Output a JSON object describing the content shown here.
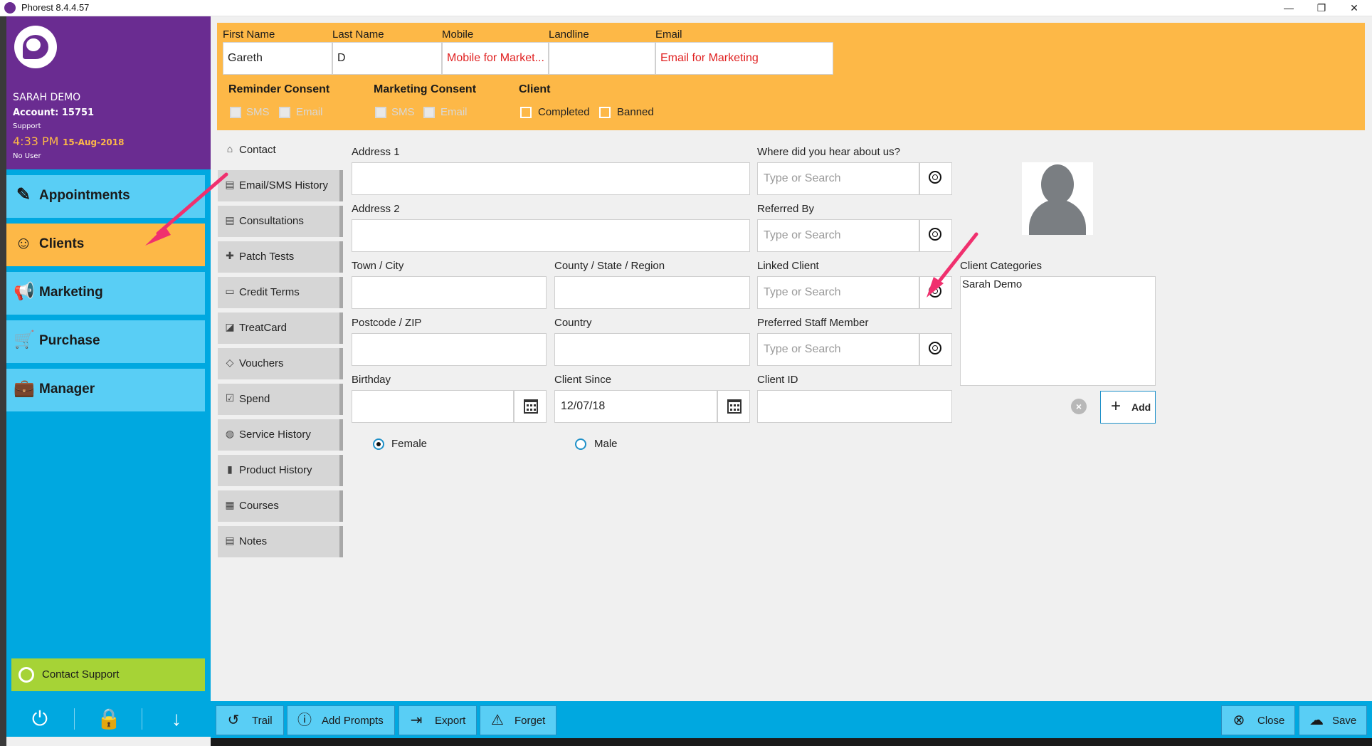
{
  "window": {
    "title": "Phorest 8.4.4.57",
    "min": "—",
    "restore": "❐",
    "close": "✕"
  },
  "profile": {
    "name": "SARAH DEMO",
    "account": "Account: 15751",
    "role": "Support",
    "time": "4:33 PM",
    "date": "15-Aug-2018",
    "user": "No User"
  },
  "nav": [
    {
      "label": "Appointments",
      "icon": "calendar-edit-icon"
    },
    {
      "label": "Clients",
      "icon": "client-head-icon"
    },
    {
      "label": "Marketing",
      "icon": "megaphone-icon"
    },
    {
      "label": "Purchase",
      "icon": "cart-icon"
    },
    {
      "label": "Manager",
      "icon": "briefcase-icon"
    }
  ],
  "contact_support": "Contact Support",
  "header": {
    "first_name_label": "First Name",
    "first_name": "Gareth",
    "last_name_label": "Last Name",
    "last_name": "D",
    "mobile_label": "Mobile",
    "mobile": "Mobile for Market...",
    "landline_label": "Landline",
    "landline": "",
    "email_label": "Email",
    "email": "Email for Marketing",
    "reminder_consent": "Reminder Consent",
    "marketing_consent": "Marketing Consent",
    "client": "Client",
    "sms": "SMS",
    "email_opt": "Email",
    "completed": "Completed",
    "banned": "Banned"
  },
  "tabs": [
    "Contact",
    "Email/SMS History",
    "Consultations",
    "Patch Tests",
    "Credit Terms",
    "TreatCard",
    "Vouchers",
    "Spend",
    "Service History",
    "Product History",
    "Courses",
    "Notes"
  ],
  "form": {
    "address1": "Address 1",
    "address2": "Address 2",
    "town": "Town / City",
    "county": "County / State / Region",
    "postcode": "Postcode / ZIP",
    "country": "Country",
    "birthday": "Birthday",
    "client_since": "Client Since",
    "client_since_value": "12/07/18",
    "where_hear": "Where did you hear about us?",
    "referred_by": "Referred By",
    "linked_client": "Linked Client",
    "preferred_staff": "Preferred Staff Member",
    "client_id": "Client ID",
    "placeholder": "Type or Search",
    "client_categories": "Client Categories",
    "category_item": "Sarah Demo",
    "add": "Add",
    "female": "Female",
    "male": "Male"
  },
  "toolbar": {
    "trail": "Trail",
    "add_prompts": "Add Prompts",
    "export": "Export",
    "forget": "Forget",
    "close": "Close",
    "save": "Save"
  },
  "colors": {
    "purple": "#6a2c91",
    "blue": "#00a8e0",
    "light_blue": "#59cef5",
    "orange": "#fdb847",
    "green": "#a6d336",
    "arrow": "#f0306e"
  }
}
